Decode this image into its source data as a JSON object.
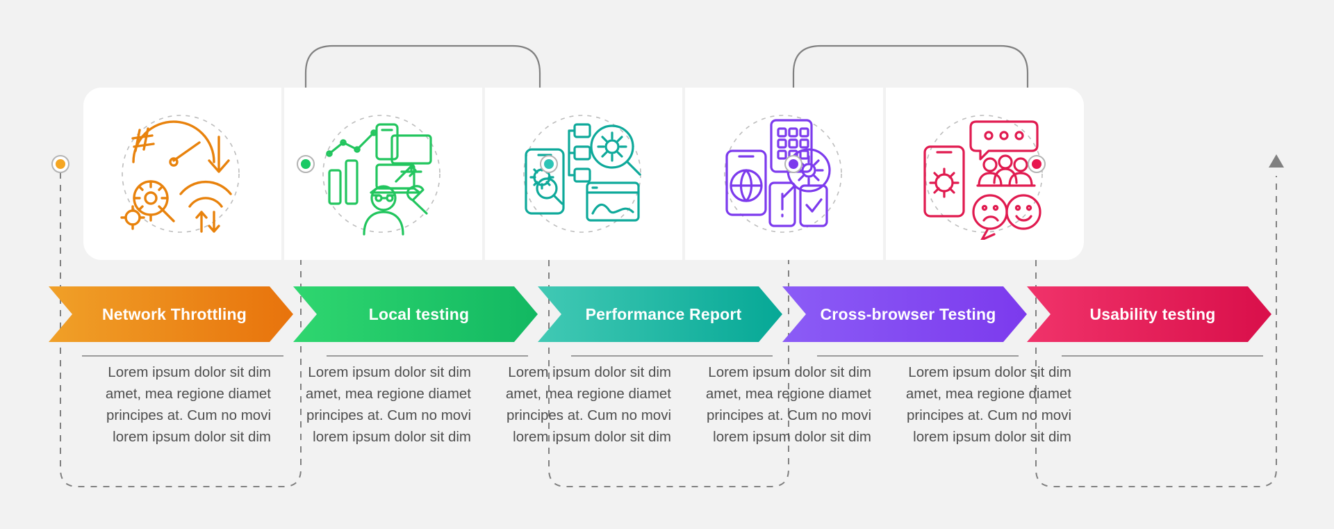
{
  "diagram": {
    "type": "process-infographic",
    "background_color": "#f2f2f2",
    "steps": [
      {
        "id": "network-throttling",
        "label": "Network Throttling",
        "color_start": "#f0a028",
        "color_end": "#e8730c",
        "node_color": "#f5a623",
        "icon": "gauge-gear-wifi-icon",
        "body": "Lorem ipsum dolor sit dim amet, mea regione diamet principes at. Cum no movi lorem ipsum dolor sit dim"
      },
      {
        "id": "local-testing",
        "label": "Local testing",
        "color_start": "#2fd66f",
        "color_end": "#12b862",
        "node_color": "#17c964",
        "icon": "developer-devices-chart-icon",
        "body": "Lorem ipsum dolor sit dim amet, mea regione diamet principes at. Cum no movi lorem ipsum dolor sit dim"
      },
      {
        "id": "performance-report",
        "label": "Performance Report",
        "color_start": "#41c9b4",
        "color_end": "#06a896",
        "node_color": "#2ec4b6",
        "icon": "mobile-search-report-icon",
        "body": "Lorem ipsum dolor sit dim amet, mea regione diamet principes at. Cum no movi lorem ipsum dolor sit dim"
      },
      {
        "id": "cross-browser-testing",
        "label": "Cross-browser Testing",
        "color_start": "#8b5cf6",
        "color_end": "#7c3aed",
        "node_color": "#7c3aed",
        "icon": "devices-browser-check-icon",
        "body": "Lorem ipsum dolor sit dim amet, mea regione diamet principes at. Cum no movi lorem ipsum dolor sit dim"
      },
      {
        "id": "usability-testing",
        "label": "Usability testing",
        "color_start": "#f0336a",
        "color_end": "#d90f4a",
        "node_color": "#e8174f",
        "icon": "user-feedback-emoji-icon",
        "body": "Lorem ipsum dolor sit dim amet, mea regione diamet principes at. Cum no movi lorem ipsum dolor sit dim"
      }
    ],
    "connector": {
      "line_color": "#808080",
      "dash_color": "#808080",
      "arrow": "up-arrow-icon"
    }
  }
}
